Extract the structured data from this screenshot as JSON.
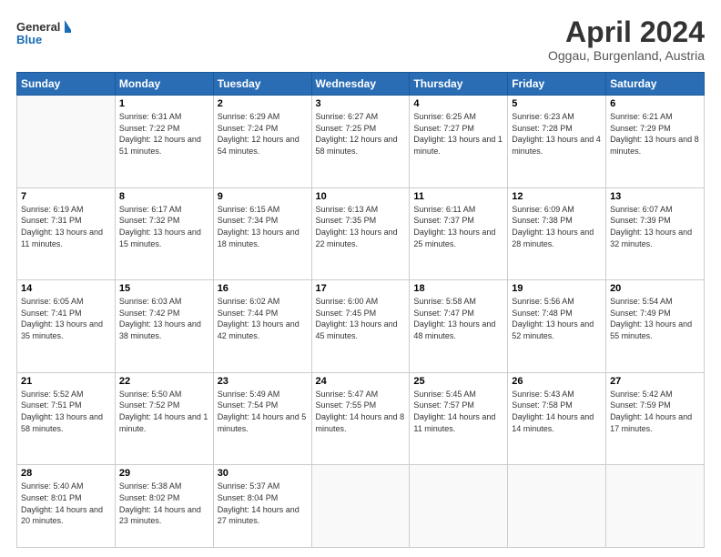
{
  "header": {
    "logo_line1": "General",
    "logo_line2": "Blue",
    "month": "April 2024",
    "location": "Oggau, Burgenland, Austria"
  },
  "weekdays": [
    "Sunday",
    "Monday",
    "Tuesday",
    "Wednesday",
    "Thursday",
    "Friday",
    "Saturday"
  ],
  "weeks": [
    [
      {
        "day": "",
        "info": ""
      },
      {
        "day": "1",
        "info": "Sunrise: 6:31 AM\nSunset: 7:22 PM\nDaylight: 12 hours\nand 51 minutes."
      },
      {
        "day": "2",
        "info": "Sunrise: 6:29 AM\nSunset: 7:24 PM\nDaylight: 12 hours\nand 54 minutes."
      },
      {
        "day": "3",
        "info": "Sunrise: 6:27 AM\nSunset: 7:25 PM\nDaylight: 12 hours\nand 58 minutes."
      },
      {
        "day": "4",
        "info": "Sunrise: 6:25 AM\nSunset: 7:27 PM\nDaylight: 13 hours\nand 1 minute."
      },
      {
        "day": "5",
        "info": "Sunrise: 6:23 AM\nSunset: 7:28 PM\nDaylight: 13 hours\nand 4 minutes."
      },
      {
        "day": "6",
        "info": "Sunrise: 6:21 AM\nSunset: 7:29 PM\nDaylight: 13 hours\nand 8 minutes."
      }
    ],
    [
      {
        "day": "7",
        "info": "Sunrise: 6:19 AM\nSunset: 7:31 PM\nDaylight: 13 hours\nand 11 minutes."
      },
      {
        "day": "8",
        "info": "Sunrise: 6:17 AM\nSunset: 7:32 PM\nDaylight: 13 hours\nand 15 minutes."
      },
      {
        "day": "9",
        "info": "Sunrise: 6:15 AM\nSunset: 7:34 PM\nDaylight: 13 hours\nand 18 minutes."
      },
      {
        "day": "10",
        "info": "Sunrise: 6:13 AM\nSunset: 7:35 PM\nDaylight: 13 hours\nand 22 minutes."
      },
      {
        "day": "11",
        "info": "Sunrise: 6:11 AM\nSunset: 7:37 PM\nDaylight: 13 hours\nand 25 minutes."
      },
      {
        "day": "12",
        "info": "Sunrise: 6:09 AM\nSunset: 7:38 PM\nDaylight: 13 hours\nand 28 minutes."
      },
      {
        "day": "13",
        "info": "Sunrise: 6:07 AM\nSunset: 7:39 PM\nDaylight: 13 hours\nand 32 minutes."
      }
    ],
    [
      {
        "day": "14",
        "info": "Sunrise: 6:05 AM\nSunset: 7:41 PM\nDaylight: 13 hours\nand 35 minutes."
      },
      {
        "day": "15",
        "info": "Sunrise: 6:03 AM\nSunset: 7:42 PM\nDaylight: 13 hours\nand 38 minutes."
      },
      {
        "day": "16",
        "info": "Sunrise: 6:02 AM\nSunset: 7:44 PM\nDaylight: 13 hours\nand 42 minutes."
      },
      {
        "day": "17",
        "info": "Sunrise: 6:00 AM\nSunset: 7:45 PM\nDaylight: 13 hours\nand 45 minutes."
      },
      {
        "day": "18",
        "info": "Sunrise: 5:58 AM\nSunset: 7:47 PM\nDaylight: 13 hours\nand 48 minutes."
      },
      {
        "day": "19",
        "info": "Sunrise: 5:56 AM\nSunset: 7:48 PM\nDaylight: 13 hours\nand 52 minutes."
      },
      {
        "day": "20",
        "info": "Sunrise: 5:54 AM\nSunset: 7:49 PM\nDaylight: 13 hours\nand 55 minutes."
      }
    ],
    [
      {
        "day": "21",
        "info": "Sunrise: 5:52 AM\nSunset: 7:51 PM\nDaylight: 13 hours\nand 58 minutes."
      },
      {
        "day": "22",
        "info": "Sunrise: 5:50 AM\nSunset: 7:52 PM\nDaylight: 14 hours\nand 1 minute."
      },
      {
        "day": "23",
        "info": "Sunrise: 5:49 AM\nSunset: 7:54 PM\nDaylight: 14 hours\nand 5 minutes."
      },
      {
        "day": "24",
        "info": "Sunrise: 5:47 AM\nSunset: 7:55 PM\nDaylight: 14 hours\nand 8 minutes."
      },
      {
        "day": "25",
        "info": "Sunrise: 5:45 AM\nSunset: 7:57 PM\nDaylight: 14 hours\nand 11 minutes."
      },
      {
        "day": "26",
        "info": "Sunrise: 5:43 AM\nSunset: 7:58 PM\nDaylight: 14 hours\nand 14 minutes."
      },
      {
        "day": "27",
        "info": "Sunrise: 5:42 AM\nSunset: 7:59 PM\nDaylight: 14 hours\nand 17 minutes."
      }
    ],
    [
      {
        "day": "28",
        "info": "Sunrise: 5:40 AM\nSunset: 8:01 PM\nDaylight: 14 hours\nand 20 minutes."
      },
      {
        "day": "29",
        "info": "Sunrise: 5:38 AM\nSunset: 8:02 PM\nDaylight: 14 hours\nand 23 minutes."
      },
      {
        "day": "30",
        "info": "Sunrise: 5:37 AM\nSunset: 8:04 PM\nDaylight: 14 hours\nand 27 minutes."
      },
      {
        "day": "",
        "info": ""
      },
      {
        "day": "",
        "info": ""
      },
      {
        "day": "",
        "info": ""
      },
      {
        "day": "",
        "info": ""
      }
    ]
  ]
}
